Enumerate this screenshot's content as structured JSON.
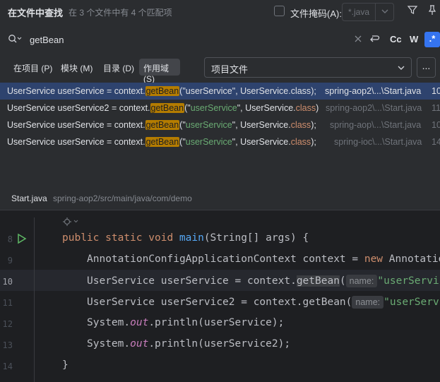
{
  "header": {
    "title": "在文件中查找",
    "info": "在 3 个文件中有 4 个匹配项",
    "file_mask_label": "文件掩码(A):",
    "file_mask_value": "*.java"
  },
  "search": {
    "query": "getBean",
    "case_label": "Cc",
    "words_label": "W",
    "regex_label": ".*"
  },
  "scope": {
    "project": "在项目 (P)",
    "module": "模块 (M)",
    "directory": "目录 (D)",
    "scope": "作用域(S)",
    "scope_value": "项目文件",
    "more": "..."
  },
  "results": [
    {
      "before": "UserService userService = context.",
      "match": "getBean",
      "after_pre": "(\"",
      "str": "userService",
      "after_mid": "\", UserService.",
      "kw": "class",
      "after_end": ");",
      "path": "spring-aop2\\...\\Start.java",
      "line": "10",
      "selected": true
    },
    {
      "before": "UserService userService2 = context.",
      "match": "getBean",
      "after_pre": "(\"",
      "str": "userService",
      "after_mid": "\", UserService.",
      "kw": "class",
      "after_end": ")",
      "path": "spring-aop2\\...\\Start.java",
      "line": "11",
      "selected": false
    },
    {
      "before": "UserService userService = context.",
      "match": "getBean",
      "after_pre": "(\"",
      "str": "userService",
      "after_mid": "\", UserService.",
      "kw": "class",
      "after_end": ");",
      "path": "spring-aop\\...\\Start.java",
      "line": "10",
      "selected": false
    },
    {
      "before": "UserService userService = context.",
      "match": "getBean",
      "after_pre": "(\"",
      "str": "userService",
      "after_mid": "\", UserService.",
      "kw": "class",
      "after_end": ");",
      "path": "spring-ioc\\...\\Start.java",
      "line": "14",
      "selected": false
    }
  ],
  "preview": {
    "file": "Start.java",
    "path": "spring-aop2/src/main/java/com/demo"
  },
  "editor": {
    "lines": [
      {
        "n": "8"
      },
      {
        "n": "9"
      },
      {
        "n": "10"
      },
      {
        "n": "11"
      },
      {
        "n": "12"
      },
      {
        "n": "13"
      },
      {
        "n": "14"
      }
    ],
    "kw_public": "public",
    "kw_static": "static",
    "kw_void": "void",
    "fn_main": "main",
    "main_args": "(String[] args) {",
    "l9": "AnnotationConfigApplicationContext context = ",
    "kw_new": "new",
    "l9_end": " AnnotationConfigApplicationContext(",
    "l10": "UserService userService = context.",
    "getbean": "getBean",
    "paren": "(",
    "hint_name": "name:",
    "str_user": "\"userService\"",
    "l11": "UserService userService2 = context.",
    "sys": "System.",
    "out": "out",
    "println1": ".println(userService);",
    "println2": ".println(userService2);",
    "close": "}"
  },
  "colors": {
    "accent": "#3574f0",
    "highlight": "#b47c00",
    "selection": "#2e436e"
  }
}
